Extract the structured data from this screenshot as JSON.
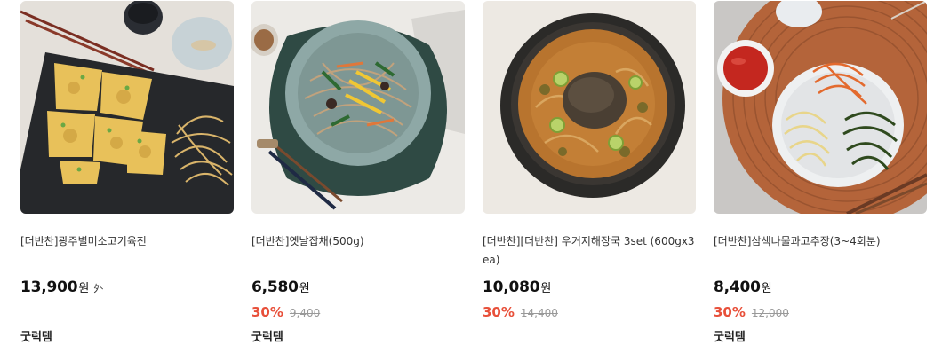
{
  "products": [
    {
      "name": "[더반찬]광주별미소고기육전",
      "price": "13,900",
      "currency": "원",
      "price_extra": "外",
      "discount_rate": "",
      "original_price": "",
      "tag": "굿럭템",
      "image": "beef-jeon-photo"
    },
    {
      "name": "[더반찬]옛날잡채(500g)",
      "price": "6,580",
      "currency": "원",
      "price_extra": "",
      "discount_rate": "30%",
      "original_price": "9,400",
      "tag": "굿럭템",
      "image": "japchae-photo"
    },
    {
      "name": "[더반찬][더반찬] 우거지해장국 3set (600gx3ea)",
      "price": "10,080",
      "currency": "원",
      "price_extra": "",
      "discount_rate": "30%",
      "original_price": "14,400",
      "tag": "",
      "image": "ugeoji-soup-photo"
    },
    {
      "name": "[더반찬]삼색나물과고추장(3~4회분)",
      "price": "8,400",
      "currency": "원",
      "price_extra": "",
      "discount_rate": "30%",
      "original_price": "12,000",
      "tag": "굿럭템",
      "image": "namul-gochujang-photo"
    }
  ]
}
